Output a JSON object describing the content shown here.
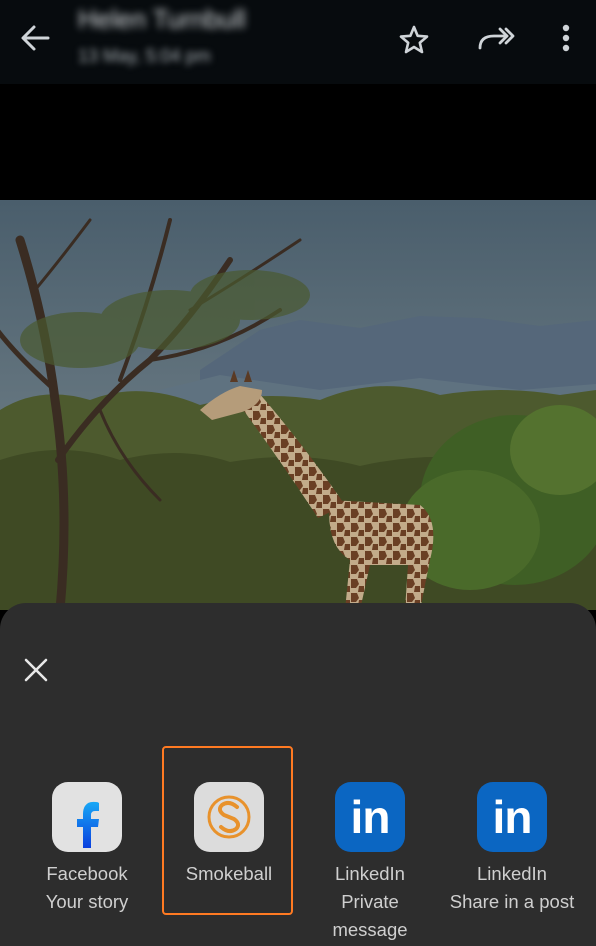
{
  "header": {
    "sender_name": "Helen Turnbull",
    "date": "13 May, 5:04 pm"
  },
  "icons": {
    "back": "arrow-left-icon",
    "star": "star-icon",
    "forward": "forward-icon",
    "more": "more-vertical-icon",
    "close": "close-icon"
  },
  "share_sheet": {
    "apps": [
      {
        "name": "Facebook",
        "sub": "Your story",
        "icon": "facebook-icon"
      },
      {
        "name": "Smokeball",
        "sub": "",
        "icon": "smokeball-icon",
        "highlighted": true
      },
      {
        "name": "LinkedIn",
        "sub": "Private message",
        "icon": "linkedin-icon",
        "icon_text": "in"
      },
      {
        "name": "LinkedIn",
        "sub": "Share in a post",
        "icon": "linkedin-icon",
        "icon_text": "in"
      }
    ]
  },
  "colors": {
    "highlight": "#ff7a22",
    "linkedin": "#0b66c2",
    "facebook": "#0866ff",
    "smokeball": "#e8922c"
  }
}
